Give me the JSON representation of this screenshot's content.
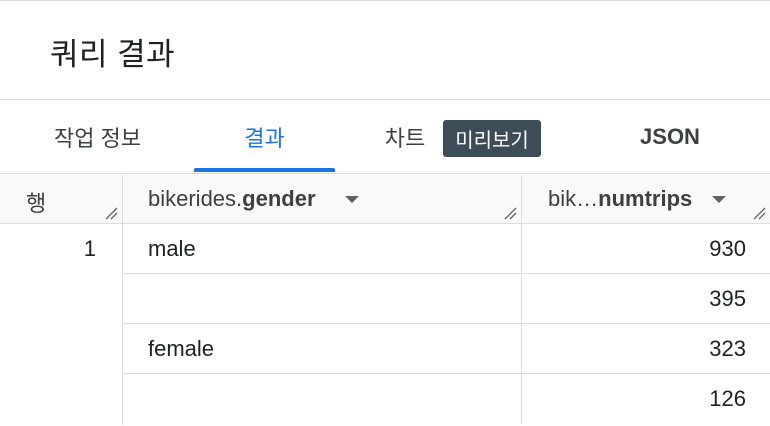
{
  "header": {
    "title": "쿼리 결과"
  },
  "tabs": {
    "job_info": "작업 정보",
    "results": "결과",
    "chart": "차트",
    "preview_badge": "미리보기",
    "json": "JSON"
  },
  "table": {
    "columns": {
      "row": "행",
      "gender_prefix": "bikerides.",
      "gender_field": "gender",
      "numtrips_prefix": "bik…",
      "numtrips_field": "numtrips"
    },
    "rows": [
      {
        "row": "1",
        "gender": "male",
        "numtrips": "930"
      },
      {
        "row": "",
        "gender": "",
        "numtrips": "395"
      },
      {
        "row": "",
        "gender": "female",
        "numtrips": "323"
      },
      {
        "row": "",
        "gender": "",
        "numtrips": "126"
      }
    ]
  }
}
